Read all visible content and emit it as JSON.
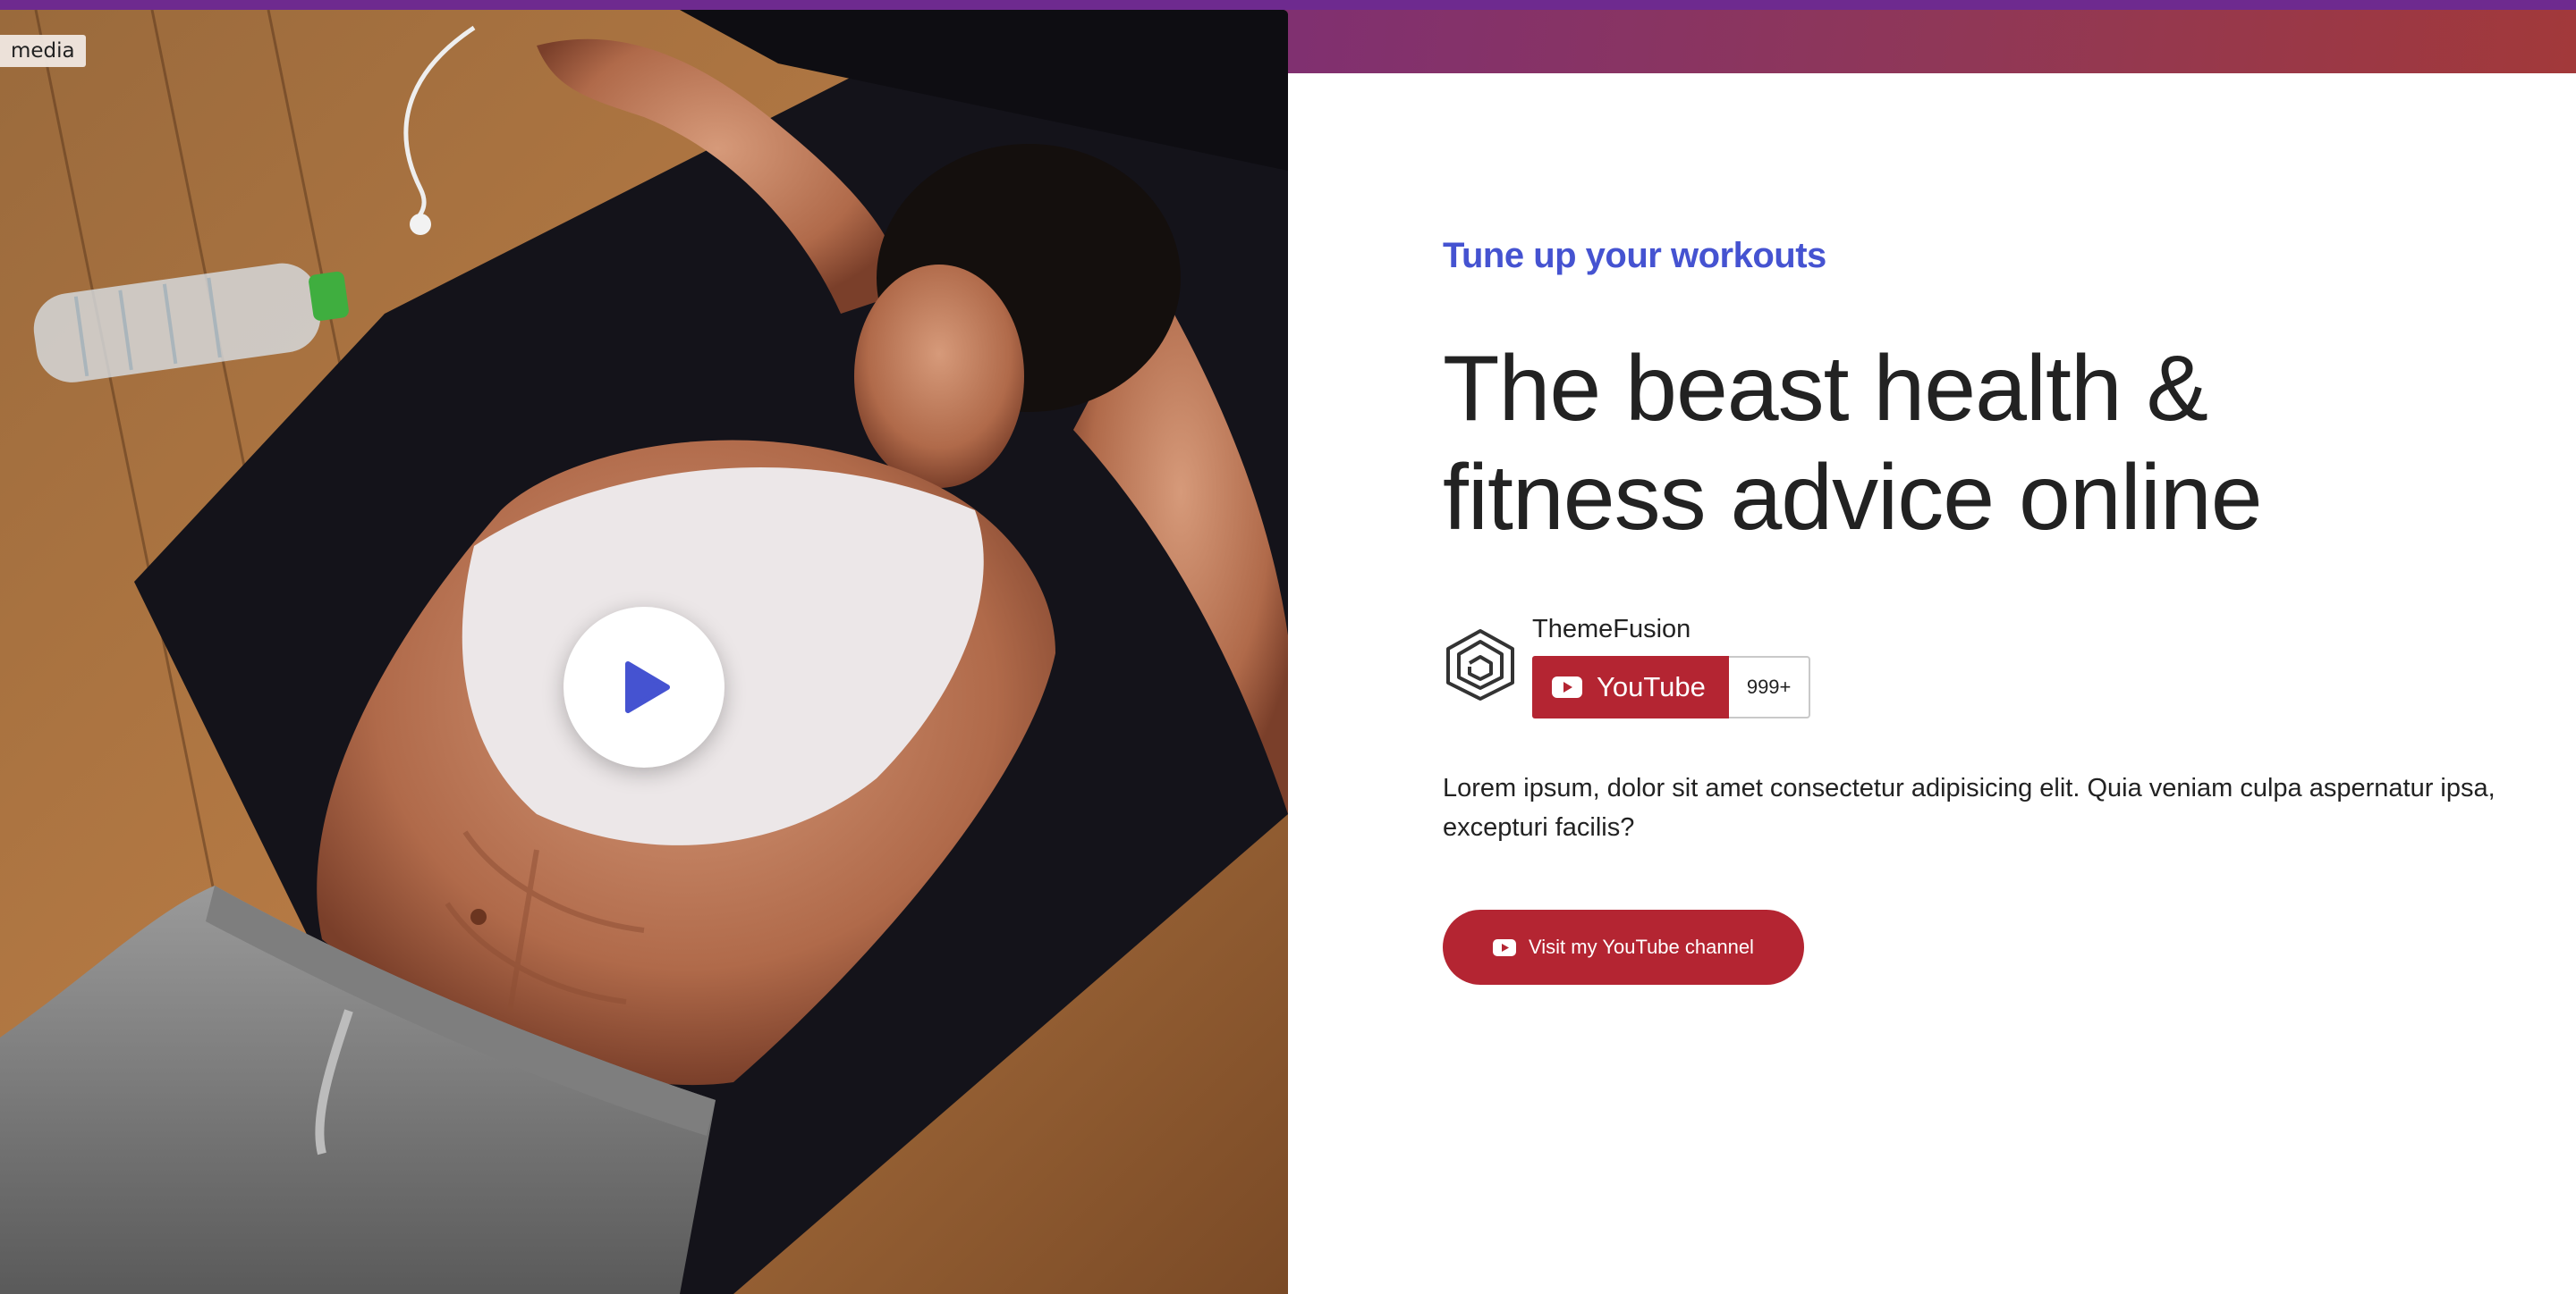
{
  "media_label": "media",
  "colors": {
    "accent": "#4553d1",
    "brand_red": "#b42532",
    "band_left": "#6b2a8a",
    "band_right": "#a2393a"
  },
  "icons": {
    "play": "play-icon",
    "logo": "themefusion-logo-icon",
    "youtube": "youtube-icon"
  },
  "hero": {
    "eyebrow": "Tune up your workouts",
    "headline_line1": "The beast health &",
    "headline_line2": "fitness advice online",
    "channel_name": "ThemeFusion",
    "subscribe_label": "YouTube",
    "subscriber_count": "999+",
    "description": "Lorem ipsum, dolor sit amet consectetur adipisicing elit. Quia veniam culpa aspernatur ipsa, excepturi facilis?",
    "cta_label": "Visit my YouTube channel"
  }
}
